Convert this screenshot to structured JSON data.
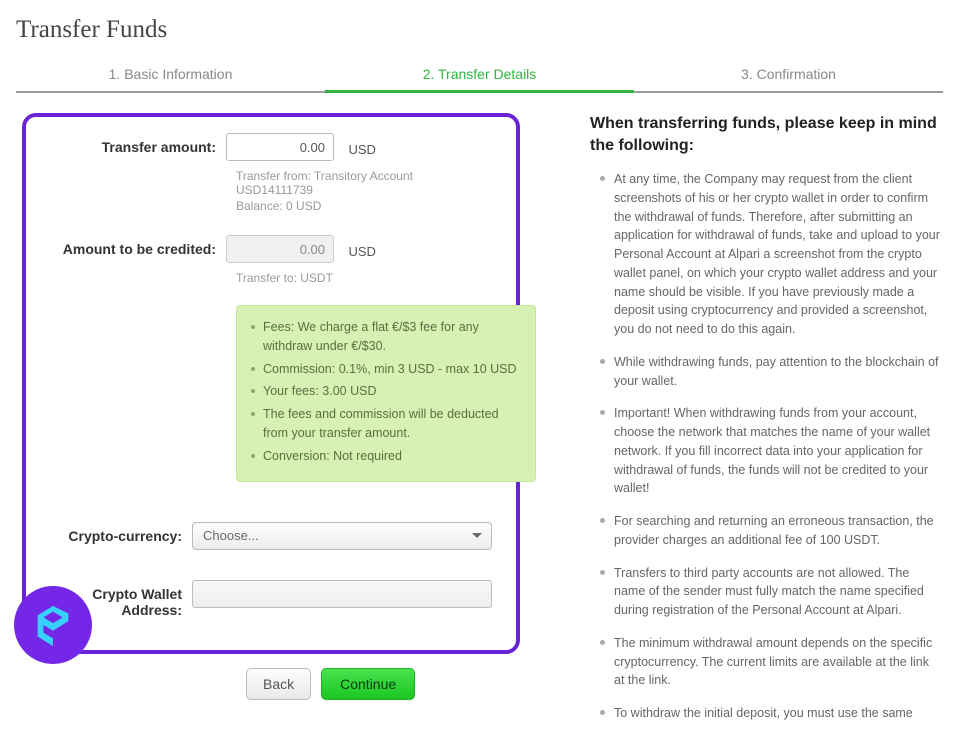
{
  "title": "Transfer Funds",
  "tabs": [
    {
      "label": "1. Basic Information"
    },
    {
      "label": "2. Transfer Details"
    },
    {
      "label": "3. Confirmation"
    }
  ],
  "form": {
    "amount": {
      "label": "Transfer amount:",
      "value": "0.00",
      "currency": "USD",
      "hint1": "Transfer from: Transitory Account USD14111739",
      "hint2": "Balance: 0 USD"
    },
    "credited": {
      "label": "Amount to be credited:",
      "value": "0.00",
      "currency": "USD",
      "hint1": "Transfer to:  USDT"
    },
    "fees": [
      "Fees: We charge a flat €/$3 fee for any withdraw under €/$30.",
      "Commission: 0.1%, min 3 USD - max 10 USD",
      "Your fees: 3.00 USD",
      "The fees and commission will be deducted from your transfer amount.",
      "Conversion: Not required"
    ],
    "crypto_currency": {
      "label": "Crypto-currency:",
      "placeholder": "Choose..."
    },
    "wallet": {
      "label": "Crypto Wallet Address:"
    },
    "back": "Back",
    "continue": "Continue"
  },
  "info": {
    "title": "When transferring funds, please keep in mind the following:",
    "items": [
      "At any time, the Company may request from the client screenshots of his or her crypto wallet in order to confirm the withdrawal of funds. Therefore, after submitting an application for withdrawal of funds, take and upload to your Personal Account at Alpari a screenshot from the crypto wallet panel, on which your crypto wallet address and your name should be visible. If you have previously made a deposit using cryptocurrency and provided a screenshot, you do not need to do this again.",
      "While withdrawing funds, pay attention to the blockchain of your wallet.",
      "Important! When withdrawing funds from your account, choose the network that matches the name of your wallet network. If you fill incorrect data into your application for withdrawal of funds, the funds will not be credited to your wallet!",
      "For searching and returning an erroneous transaction, the provider charges an additional fee of 100 USDT.",
      "Transfers to third party accounts are not allowed. The name of the sender must fully match the name specified during registration of the Personal Account at Alpari.",
      "The minimum withdrawal amount depends on the specific cryptocurrency. The current limits are available at the link at the link.",
      "To withdraw the initial deposit, you must use the same"
    ]
  }
}
